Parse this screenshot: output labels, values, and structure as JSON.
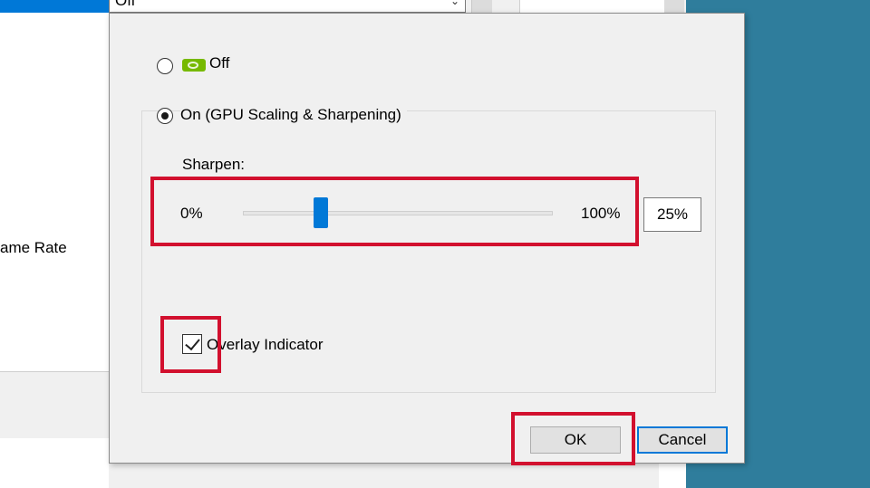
{
  "background": {
    "dropdown_value": "Off",
    "frame_rate_label": "ame Rate"
  },
  "dialog": {
    "radio_off_label": "Off",
    "radio_on_label": "On (GPU Scaling & Sharpening)",
    "selected_option": "on",
    "sharpen": {
      "label": "Sharpen:",
      "min_label": "0%",
      "max_label": "100%",
      "value": 25,
      "value_text": "25%"
    },
    "overlay_indicator": {
      "label": "Overlay Indicator",
      "checked": true
    },
    "buttons": {
      "ok": "OK",
      "cancel": "Cancel"
    }
  },
  "colors": {
    "desktop_bg": "#2f7d9c",
    "accent": "#0078d7",
    "nvidia_green": "#76b900",
    "highlight": "#d2102e"
  },
  "icons": {
    "nvidia_logo": "nvidia-logo-icon"
  }
}
